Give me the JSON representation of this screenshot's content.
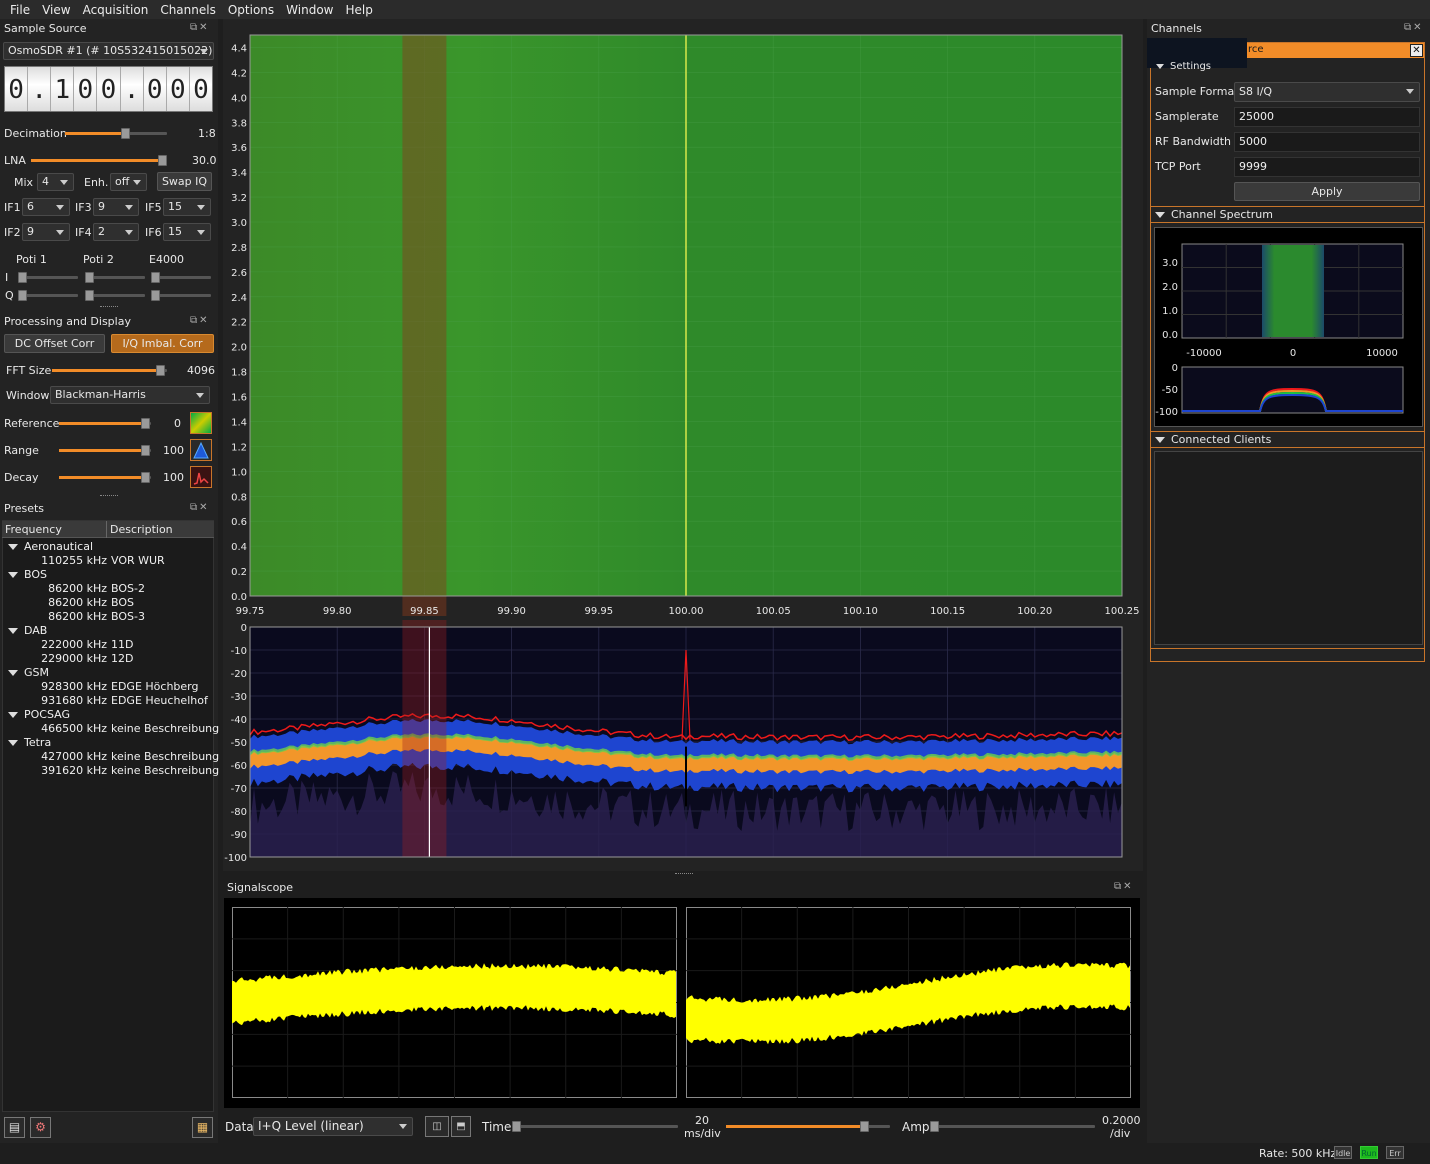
{
  "menu": [
    "File",
    "View",
    "Acquisition",
    "Channels",
    "Options",
    "Window",
    "Help"
  ],
  "sample_source": {
    "title": "Sample Source",
    "device": "OsmoSDR #1 (# 10S532415015022)",
    "frequency_digits": [
      "0",
      ".",
      "1",
      "0",
      "0",
      ".",
      "0",
      "0",
      "0"
    ],
    "decimation_label": "Decimation",
    "decimation_value": "1:8",
    "decimation_level": 0.65,
    "lna_label": "LNA",
    "lna_value": "30.0",
    "lna_level": 1.0,
    "mix_label": "Mix",
    "mix_value": "4",
    "enh_label": "Enh.",
    "enh_value": "off",
    "swap_iq": "Swap IQ",
    "if": [
      {
        "label": "IF1",
        "value": "6"
      },
      {
        "label": "IF3",
        "value": "9"
      },
      {
        "label": "IF5",
        "value": "15"
      },
      {
        "label": "IF2",
        "value": "9"
      },
      {
        "label": "IF4",
        "value": "2"
      },
      {
        "label": "IF6",
        "value": "15"
      }
    ],
    "poti1": "Poti 1",
    "poti2": "Poti 2",
    "e4000": "E4000",
    "i_label": "I",
    "q_label": "Q"
  },
  "processing": {
    "title": "Processing and Display",
    "dc_offset": "DC Offset Corr",
    "iq_imbal": "I/Q Imbal. Corr",
    "fft_label": "FFT Size",
    "fft_value": "4096",
    "fft_level": 1.0,
    "window_label": "Window",
    "window_value": "Blackman-Harris",
    "reference_label": "Reference",
    "reference_value": "0",
    "range_label": "Range",
    "range_value": "100",
    "decay_label": "Decay",
    "decay_value": "100"
  },
  "presets": {
    "title": "Presets",
    "col_frequency": "Frequency",
    "col_description": "Description",
    "groups": [
      {
        "name": "Aeronautical",
        "items": [
          [
            "110255 kHz",
            "VOR WUR"
          ]
        ]
      },
      {
        "name": "BOS",
        "items": [
          [
            "86200 kHz",
            "BOS-2"
          ],
          [
            "86200 kHz",
            "BOS"
          ],
          [
            "86200 kHz",
            "BOS-3"
          ]
        ]
      },
      {
        "name": "DAB",
        "items": [
          [
            "222000 kHz",
            "11D"
          ],
          [
            "229000 kHz",
            "12D"
          ]
        ]
      },
      {
        "name": "GSM",
        "items": [
          [
            "928300 kHz",
            "EDGE Höchberg"
          ],
          [
            "931680 kHz",
            "EDGE Heuchelhof"
          ]
        ]
      },
      {
        "name": "POCSAG",
        "items": [
          [
            "466500 kHz",
            "keine Beschreibung"
          ]
        ]
      },
      {
        "name": "Tetra",
        "items": [
          [
            "427000 kHz",
            "keine Beschreibung"
          ],
          [
            "391620 kHz",
            "keine Beschreibung"
          ]
        ]
      }
    ]
  },
  "waterfall": {
    "y_ticks": [
      "4.4",
      "4.2",
      "4.0",
      "3.8",
      "3.6",
      "3.4",
      "3.2",
      "3.0",
      "2.8",
      "2.6",
      "2.4",
      "2.2",
      "2.0",
      "1.8",
      "1.6",
      "1.4",
      "1.2",
      "1.0",
      "0.8",
      "0.6",
      "0.4",
      "0.2",
      "0.0"
    ],
    "x_ticks": [
      "99.75",
      "99.80",
      "99.85",
      "99.90",
      "99.95",
      "100.00",
      "100.05",
      "100.10",
      "100.15",
      "100.20",
      "100.25"
    ],
    "selected_freq": "99.85"
  },
  "spectrum": {
    "y_ticks": [
      "0",
      "-10",
      "-20",
      "-30",
      "-40",
      "-50",
      "-60",
      "-70",
      "-80",
      "-90",
      "-100"
    ]
  },
  "signalscope": {
    "title": "Signalscope",
    "data_label": "Data",
    "data_value": "I+Q Level (linear)",
    "time_label": "Time",
    "time_value_top": "20",
    "time_value_bottom": "ms/div",
    "amp_label": "Amp",
    "amp_value_top": "0.2000",
    "amp_value_bottom": "/div"
  },
  "channels": {
    "title": "Channels",
    "tab_text": "rce",
    "settings_header": "Settings",
    "sample_format_label": "Sample Format",
    "sample_format_value": "S8 I/Q",
    "samplerate_label": "Samplerate",
    "samplerate_value": "25000",
    "rf_bw_label": "RF Bandwidth",
    "rf_bw_value": "5000",
    "tcp_port_label": "TCP Port",
    "tcp_port_value": "9999",
    "apply": "Apply",
    "channel_spectrum_header": "Channel Spectrum",
    "cs_y_ticks": [
      "3.0",
      "2.0",
      "1.0",
      "0.0"
    ],
    "cs_x_ticks": [
      "-10000",
      "0",
      "10000"
    ],
    "cs_db_ticks": [
      "0",
      "-50",
      "-100"
    ],
    "connected_clients_header": "Connected Clients"
  },
  "status": {
    "rate": "Rate: 500 kHz",
    "idle": "Idle",
    "run": "Run",
    "err": "Err"
  },
  "colors": {
    "accent": "#f28c28",
    "waterfall_green": "#2d8a2a",
    "trace": "#ffff00"
  }
}
